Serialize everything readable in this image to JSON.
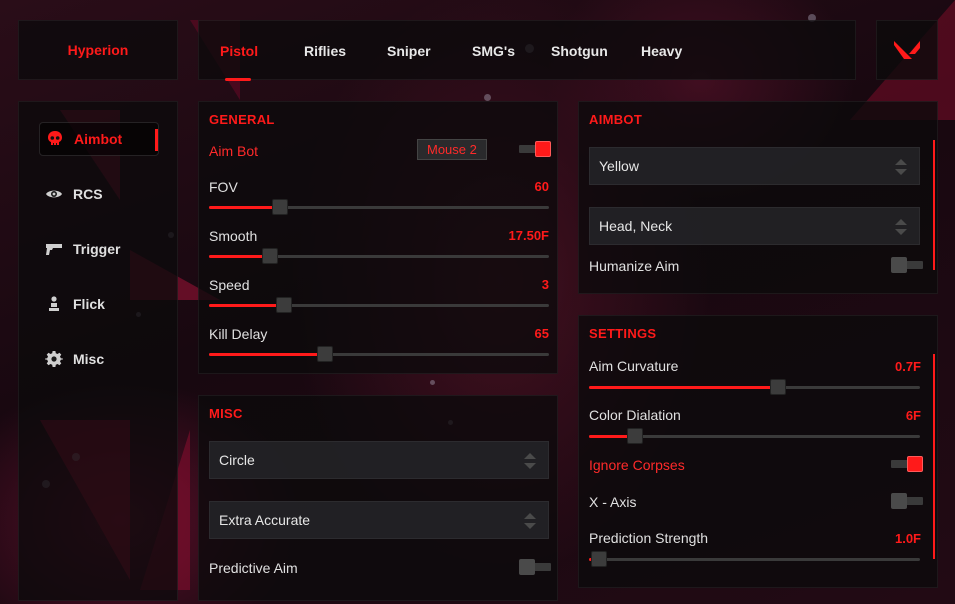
{
  "brand": "Hyperion",
  "tabs": [
    "Pistol",
    "Riflies",
    "Sniper",
    "SMG's",
    "Shotgun",
    "Heavy"
  ],
  "sidebar": {
    "items": [
      {
        "label": "Aimbot",
        "icon": "skull-icon"
      },
      {
        "label": "RCS",
        "icon": "eye-icon"
      },
      {
        "label": "Trigger",
        "icon": "pistol-icon"
      },
      {
        "label": "Flick",
        "icon": "person-icon"
      },
      {
        "label": "Misc",
        "icon": "gear-icon"
      }
    ]
  },
  "general": {
    "title": "GENERAL",
    "aimbot_label": "Aim Bot",
    "aimbot_key": "Mouse 2",
    "aimbot_enabled": true,
    "sliders": [
      {
        "label": "FOV",
        "value": "60",
        "level": 0.21
      },
      {
        "label": "Smooth",
        "value": "17.50F",
        "level": 0.18
      },
      {
        "label": "Speed",
        "value": "3",
        "level": 0.22
      },
      {
        "label": "Kill Delay",
        "value": "65",
        "level": 0.34
      }
    ]
  },
  "misc": {
    "title": "MISC",
    "select1": "Circle",
    "select2": "Extra Accurate",
    "predictive_label": "Predictive Aim",
    "predictive_enabled": false
  },
  "aimbot": {
    "title": "AIMBOT",
    "select1": "Yellow",
    "select2": "Head, Neck",
    "humanize_label": "Humanize Aim",
    "humanize_enabled": false
  },
  "settings": {
    "title": "SETTINGS",
    "curvature": {
      "label": "Aim Curvature",
      "value": "0.7F",
      "level": 0.57
    },
    "dialation": {
      "label": "Color Dialation",
      "value": "6F",
      "level": 0.14
    },
    "ignore_label": "Ignore Corpses",
    "ignore_enabled": true,
    "xaxis_label": "X - Axis",
    "xaxis_enabled": false,
    "prediction": {
      "label": "Prediction Strength",
      "value": "1.0F",
      "level": 0.03
    }
  },
  "colors": {
    "accent": "#ff1a1a",
    "panel": "#0c0a0c"
  }
}
